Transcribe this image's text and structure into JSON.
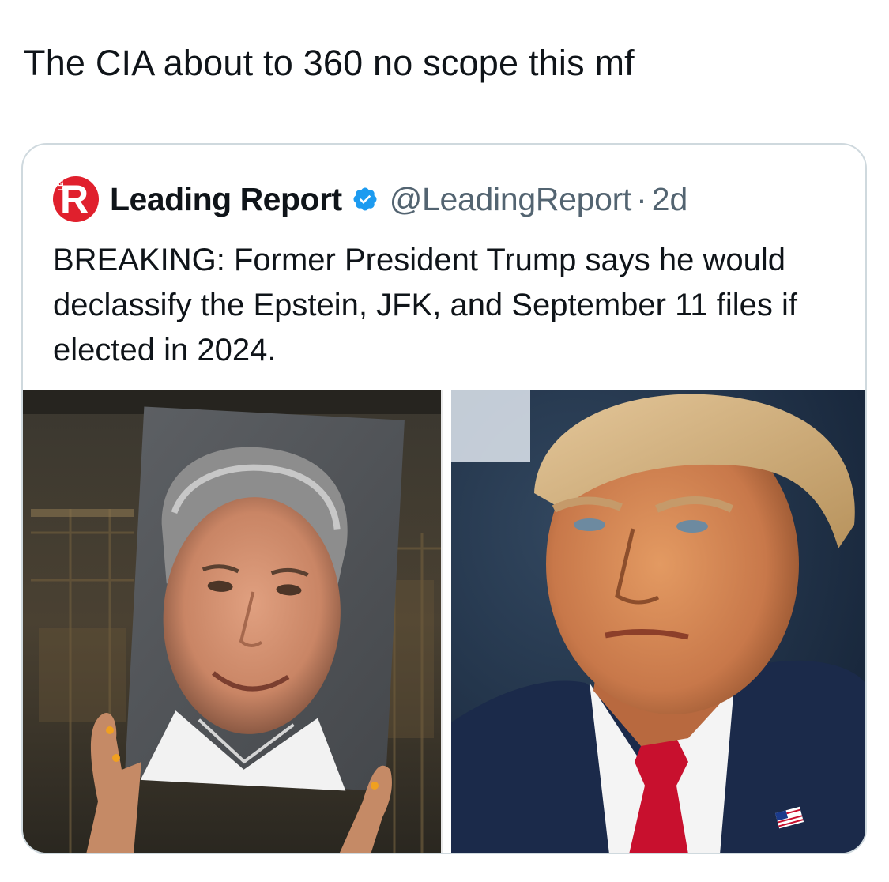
{
  "post": {
    "caption": "The CIA about to 360 no scope this mf"
  },
  "quoted_tweet": {
    "author_name": "Leading Report",
    "handle": "@LeadingReport",
    "separator": "·",
    "time": "2d",
    "avatar_letter": "R",
    "avatar_sub": "LEADING",
    "verified_icon": "verified-badge-icon",
    "text": "BREAKING: Former President Trump says he would declassify the Epstein, JFK, and September 11 files if elected in 2024.",
    "media": [
      {
        "alt": "photo-protest-sign"
      },
      {
        "alt": "photo-portrait"
      }
    ]
  },
  "colors": {
    "text_primary": "#0f1419",
    "text_secondary": "#536471",
    "card_border": "#cfd9de",
    "verified_blue": "#1d9bf0",
    "avatar_red": "#e0202d"
  }
}
